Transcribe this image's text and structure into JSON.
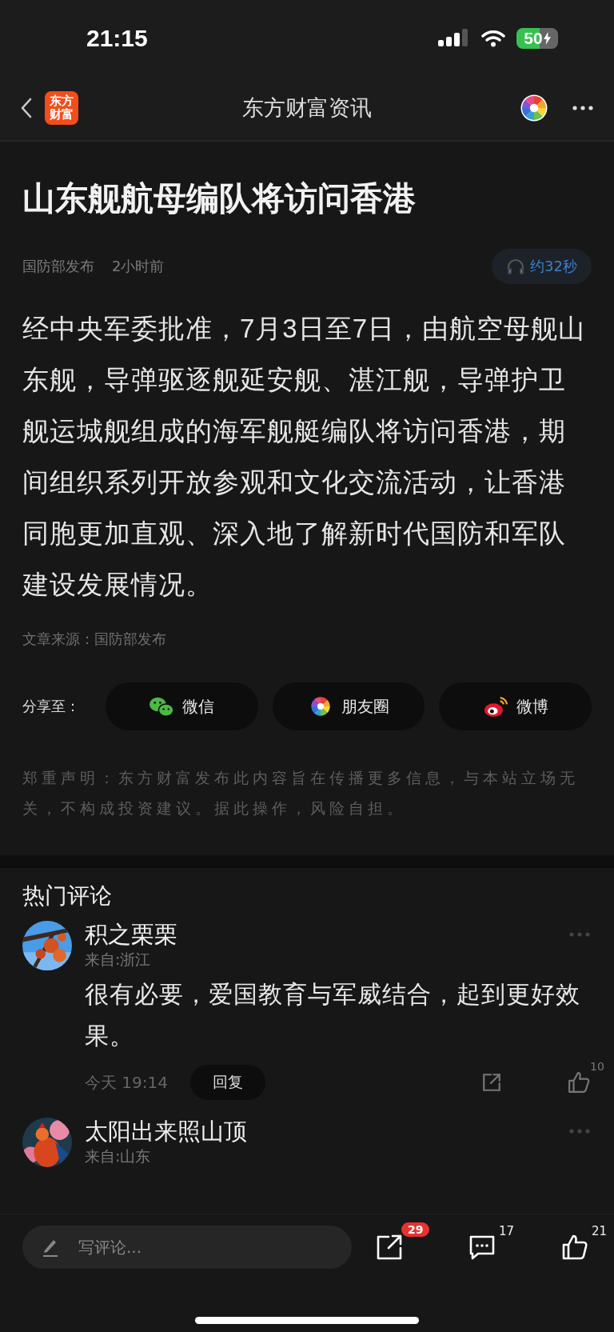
{
  "status_bar": {
    "time": "21:15",
    "battery": "50"
  },
  "nav": {
    "logo": [
      "东方",
      "财富"
    ],
    "title": "东方财富资讯"
  },
  "article": {
    "title": "山东舰航母编队将访问香港",
    "publisher": "国防部发布",
    "time": "2小时前",
    "audio": "约32秒",
    "body": "经中央军委批准，7月3日至7日，由航空母舰山东舰，导弹驱逐舰延安舰、湛江舰，导弹护卫舰运城舰组成的海军舰艇编队将访问香港，期间组织系列开放参观和文化交流活动，让香港同胞更加直观、深入地了解新时代国防和军队建设发展情况。",
    "source": "文章来源：国防部发布"
  },
  "share": {
    "label": "分享至：",
    "targets": [
      {
        "kind": "wechat",
        "label": "微信"
      },
      {
        "kind": "moments",
        "label": "朋友圈"
      },
      {
        "kind": "weibo",
        "label": "微博"
      }
    ]
  },
  "disclaimer": "郑重声明：东方财富发布此内容旨在传播更多信息，与本站立场无关，不构成投资建议。据此操作，风险自担。",
  "comments": {
    "title": "热门评论",
    "items": [
      {
        "name": "积之栗栗",
        "location": "来自:浙江",
        "text": "很有必要，爱国教育与军威结合，起到更好效果。",
        "time": "今天 19:14",
        "reply": "回复",
        "likes": "10"
      },
      {
        "name": "太阳出来照山顶",
        "location": "来自:山东"
      }
    ]
  },
  "bottom_bar": {
    "placeholder": "写评论...",
    "shares": "29",
    "comments": "17",
    "likes": "21"
  }
}
